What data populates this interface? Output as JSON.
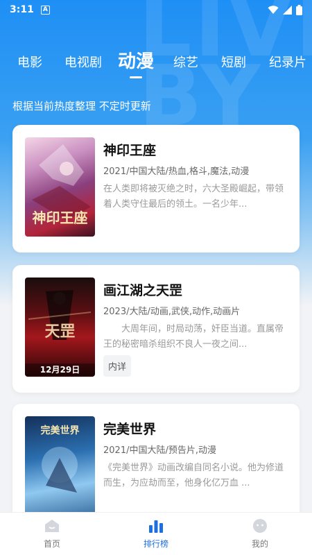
{
  "status_bar": {
    "time": "3:11",
    "notification_icon": "a-letter-icon",
    "icons": [
      "wifi-icon",
      "signal-icon",
      "battery-icon"
    ]
  },
  "tabs": [
    {
      "label": "电影",
      "active": false
    },
    {
      "label": "电视剧",
      "active": false
    },
    {
      "label": "动漫",
      "active": true
    },
    {
      "label": "综艺",
      "active": false
    },
    {
      "label": "短剧",
      "active": false
    },
    {
      "label": "纪录片",
      "active": false
    }
  ],
  "subtitle": "根据当前热度整理 不定时更新",
  "cards": [
    {
      "title": "神印王座",
      "meta": "2021/中国大陆/热血,格斗,魔法,动漫",
      "description": "在人类即将被灭绝之时，六大圣殿崛起，带领着人类守住最后的领土。一名少年...",
      "poster_text": "神印王座",
      "tag": ""
    },
    {
      "title": "画江湖之天罡",
      "meta": "2023/大陆/动画,武侠,动作,动画片",
      "description": "　　大周年间，时局动荡，奸臣当道。直属帝王的秘密暗杀组织不良人一夜之间...",
      "poster_text": "天罡",
      "poster_date": "12月29日",
      "tag": "内详"
    },
    {
      "title": "完美世界",
      "meta": "2021/中国大陆/预告片,动漫",
      "description": "《完美世界》动画改编自同名小说。他为修道而生，为应劫而至，他身化亿万血 ...",
      "poster_text": "完美世界",
      "tag": ""
    }
  ],
  "bottom_nav": [
    {
      "label": "首页",
      "icon": "home-icon",
      "active": false
    },
    {
      "label": "排行榜",
      "icon": "ranking-icon",
      "active": true
    },
    {
      "label": "我的",
      "icon": "profile-icon",
      "active": false
    }
  ],
  "colors": {
    "accent": "#1e6fe0",
    "header_gradient_top": "#1e8ff5",
    "background": "#f1f3f6"
  }
}
